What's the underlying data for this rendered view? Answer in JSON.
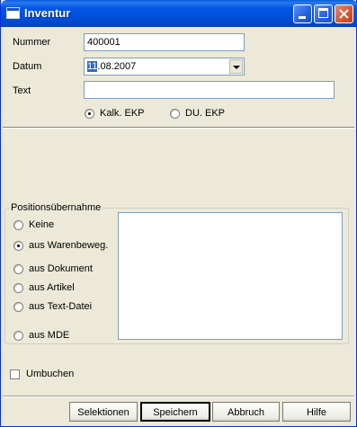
{
  "window": {
    "title": "Inventur"
  },
  "form": {
    "nummer_label": "Nummer",
    "nummer_value": "400001",
    "datum_label": "Datum",
    "datum_day_selected": "11",
    "datum_rest": ".08.2007",
    "text_label": "Text",
    "text_value": ""
  },
  "price_options": [
    {
      "label": "Kalk. EKP",
      "selected": true
    },
    {
      "label": "DU. EKP",
      "selected": false
    }
  ],
  "positions": {
    "title": "Positionsübernahme",
    "options": [
      {
        "label": "Keine",
        "selected": false
      },
      {
        "label": "aus Warenbeweg.",
        "selected": true
      },
      {
        "label": "aus Dokument",
        "selected": false
      },
      {
        "label": "aus Artikel",
        "selected": false
      },
      {
        "label": "aus Text-Datei",
        "selected": false
      },
      {
        "label": "aus MDE",
        "selected": false
      }
    ]
  },
  "umbuchen": {
    "label": "Umbuchen",
    "checked": false
  },
  "buttons": {
    "selektionen": "Selektionen",
    "speichern": "Speichern",
    "abbruch": "Abbruch",
    "hilfe": "Hilfe"
  }
}
